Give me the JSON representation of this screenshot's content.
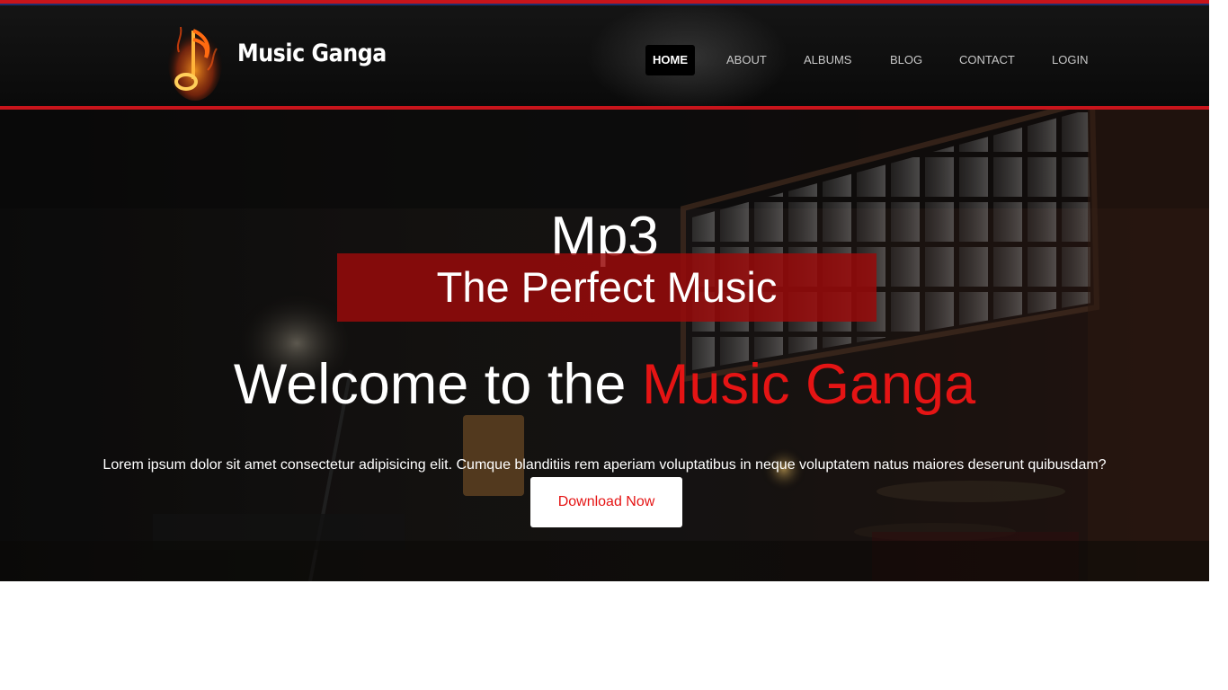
{
  "header": {
    "brand": "Music Ganga",
    "nav": [
      {
        "label": "HOME",
        "active": true
      },
      {
        "label": "ABOUT",
        "active": false
      },
      {
        "label": "ALBUMS",
        "active": false
      },
      {
        "label": "BLOG",
        "active": false
      },
      {
        "label": "CONTACT",
        "active": false
      },
      {
        "label": "LOGIN",
        "active": false
      }
    ]
  },
  "hero": {
    "title": "Mp3",
    "tagline": "The Perfect Music",
    "welcome_prefix": "Welcome to the",
    "welcome_accent": "Music Ganga",
    "description": "Lorem ipsum dolor sit amet consectetur adipisicing elit. Cumque blanditiis rem aperiam voluptatibus in neque voluptatem natus maiores deserunt quibusdam?",
    "cta_label": "Download Now"
  },
  "colors": {
    "accent_red": "#e51414",
    "bar_red": "#c8141b",
    "tagline_bg": "#990a0a"
  },
  "icons": {
    "logo": "flaming-music-note-icon"
  }
}
